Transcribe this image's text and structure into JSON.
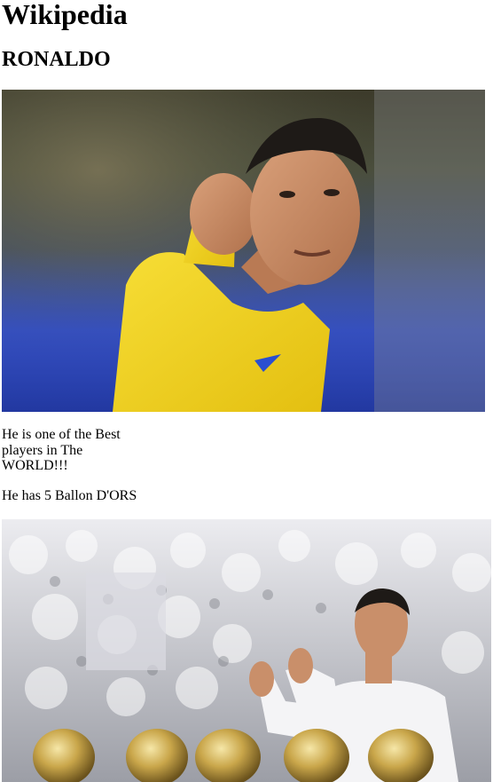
{
  "site": {
    "title": "Wikipedia"
  },
  "article": {
    "title": "RONALDO",
    "paragraphs": [
      "He is one of the Best players in The WORLD!!!",
      "He has 5 Ballon D'ORS"
    ]
  },
  "images": [
    {
      "name": "ronaldo-photo-yellow-kit"
    },
    {
      "name": "ronaldo-ballon-dor-trophies-photo"
    }
  ],
  "colors": {
    "kit_yellow": "#f2d21a",
    "stadium_blue": "#2b43b0",
    "trophy_gold": "#c9a64a",
    "crowd_white": "#e6e6ea"
  }
}
